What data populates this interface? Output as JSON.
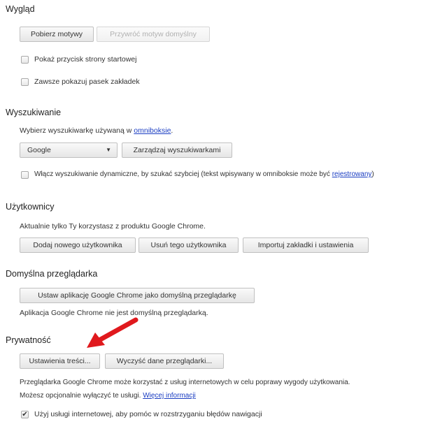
{
  "appearance": {
    "title": "Wygląd",
    "get_themes": "Pobierz motywy",
    "reset_theme": "Przywróć motyw domyślny",
    "show_home": "Pokaż przycisk strony startowej",
    "show_bookmarks": "Zawsze pokazuj pasek zakładek"
  },
  "search": {
    "title": "Wyszukiwanie",
    "desc_prefix": "Wybierz wyszukiwarkę używaną w ",
    "desc_link": "omniboksie",
    "desc_suffix": ".",
    "engine": "Google",
    "manage": "Zarządzaj wyszukiwarkami",
    "instant_prefix": "Włącz wyszukiwanie dynamiczne, by szukać szybciej (tekst wpisywany w omniboksie może być ",
    "instant_link": "rejestrowany",
    "instant_suffix": ")"
  },
  "users": {
    "title": "Użytkownicy",
    "desc": "Aktualnie tylko Ty korzystasz z produktu Google Chrome.",
    "add": "Dodaj nowego użytkownika",
    "remove": "Usuń tego użytkownika",
    "import": "Importuj zakładki i ustawienia"
  },
  "default_browser": {
    "title": "Domyślna przeglądarka",
    "make_default": "Ustaw aplikację Google Chrome jako domyślną przeglądarkę",
    "status": "Aplikacja Google Chrome nie jest domyślną przeglądarką."
  },
  "privacy": {
    "title": "Prywatność",
    "content_settings": "Ustawienia treści...",
    "clear_data": "Wyczyść dane przeglądarki...",
    "desc1": "Przeglądarka Google Chrome może korzystać z usług internetowych w celu poprawy wygody użytkowania.",
    "desc2_prefix": "Możesz opcjonalnie wyłączyć te usługi. ",
    "desc2_link": "Więcej informacji",
    "nav_errors": "Użyj usługi internetowej, aby pomóc w rozstrzyganiu błędów nawigacji"
  },
  "colors": {
    "arrow": "#e0191d",
    "link": "#1a3dc2"
  }
}
